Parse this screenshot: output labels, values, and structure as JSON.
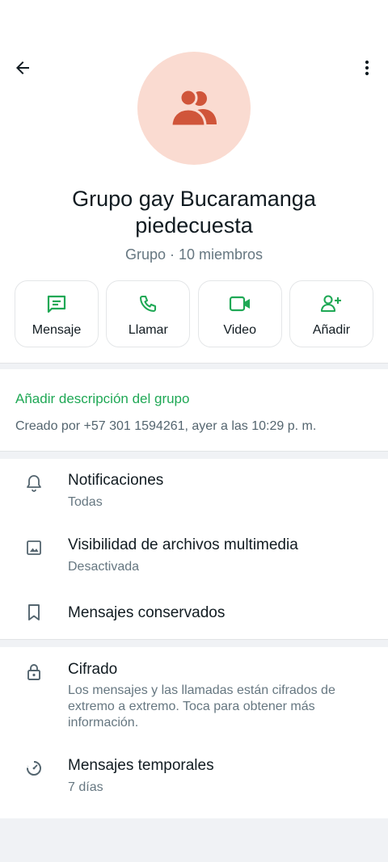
{
  "header": {
    "back_icon": "arrow-left-icon",
    "menu_icon": "more-vertical-icon"
  },
  "profile": {
    "avatar_icon": "group-icon",
    "name": "Grupo gay Bucaramanga piedecuesta",
    "subtitle": "Grupo · 10 miembros"
  },
  "actions": [
    {
      "label": "Mensaje",
      "icon": "message-icon"
    },
    {
      "label": "Llamar",
      "icon": "phone-icon"
    },
    {
      "label": "Video",
      "icon": "video-icon"
    },
    {
      "label": "Añadir",
      "icon": "add-person-icon"
    }
  ],
  "description": {
    "add_link": "Añadir descripción del grupo",
    "created_by": "Creado por +57 301 1594261, ayer a las 10:29 p. m."
  },
  "settings": [
    {
      "title": "Notificaciones",
      "subtitle": "Todas",
      "icon": "bell-icon"
    },
    {
      "title": "Visibilidad de archivos multimedia",
      "subtitle": "Desactivada",
      "icon": "image-icon"
    },
    {
      "title": "Mensajes conservados",
      "icon": "bookmark-icon"
    }
  ],
  "security": [
    {
      "title": "Cifrado",
      "subtitle": "Los mensajes y las llamadas están cifrados de extremo a extremo. Toca para obtener más información.",
      "icon": "lock-icon"
    },
    {
      "title": "Mensajes temporales",
      "subtitle": "7 días",
      "icon": "timer-icon"
    }
  ],
  "colors": {
    "accent": "#1fa855",
    "avatar_bg": "#fadbd1",
    "avatar_fg": "#d0553a"
  }
}
